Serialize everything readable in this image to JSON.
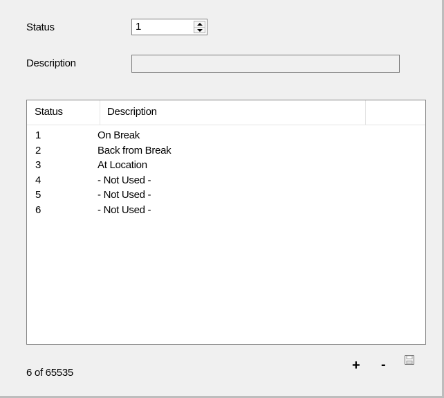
{
  "form": {
    "status_label": "Status",
    "status_value": "1",
    "description_label": "Description",
    "description_value": ""
  },
  "grid": {
    "columns": [
      "Status",
      "Description",
      ""
    ],
    "rows": [
      {
        "status": "1",
        "description": "On Break"
      },
      {
        "status": "2",
        "description": "Back from Break"
      },
      {
        "status": "3",
        "description": "At Location"
      },
      {
        "status": "4",
        "description": "- Not Used -"
      },
      {
        "status": "5",
        "description": "- Not Used -"
      },
      {
        "status": "6",
        "description": "- Not Used -"
      }
    ]
  },
  "footer": {
    "count": "6 of 65535",
    "add_label": "+",
    "remove_label": "-",
    "save_icon": "save-icon"
  }
}
